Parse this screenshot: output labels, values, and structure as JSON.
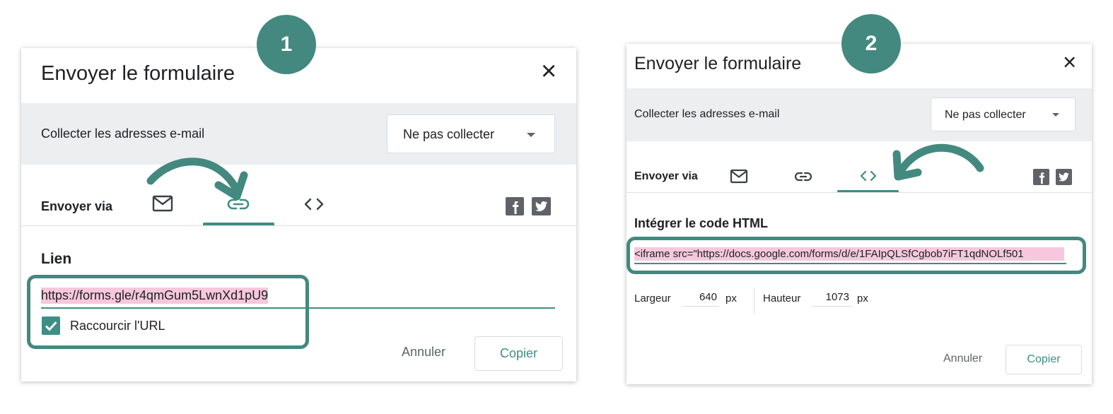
{
  "colors": {
    "accent": "#3d8e84",
    "highlight_bg": "#f7c8dd",
    "badge": "#43897f",
    "gray_bar": "#eceef0"
  },
  "step1": {
    "badge": "1",
    "title": "Envoyer le formulaire",
    "close_icon": "×",
    "collect_label": "Collecter les adresses e-mail",
    "collect_value": "Ne pas collecter",
    "send_via": "Envoyer via",
    "tabs": [
      {
        "icon": "mail-icon",
        "selected": false
      },
      {
        "icon": "link-icon",
        "selected": true
      },
      {
        "icon": "code-icon",
        "selected": false
      }
    ],
    "section_title": "Lien",
    "link_value": "https://forms.gle/r4qmGum5LwnXd1pU9",
    "shorten_label": "Raccourcir l'URL",
    "shorten_checked": true,
    "cancel": "Annuler",
    "copy": "Copier"
  },
  "step2": {
    "badge": "2",
    "title": "Envoyer le formulaire",
    "close_icon": "×",
    "collect_label": "Collecter les adresses e-mail",
    "collect_value": "Ne pas collecter",
    "send_via": "Envoyer via",
    "tabs": [
      {
        "icon": "mail-icon",
        "selected": false
      },
      {
        "icon": "link-icon",
        "selected": false
      },
      {
        "icon": "code-icon",
        "selected": true
      }
    ],
    "section_title": "Intégrer le code HTML",
    "embed_value": "<iframe src=\"https://docs.google.com/forms/d/e/1FAIpQLSfCgbob7iFT1qdNOLf501",
    "width_label": "Largeur",
    "width_value": "640",
    "height_label": "Hauteur",
    "height_value": "1073",
    "unit": "px",
    "cancel": "Annuler",
    "copy": "Copier"
  }
}
